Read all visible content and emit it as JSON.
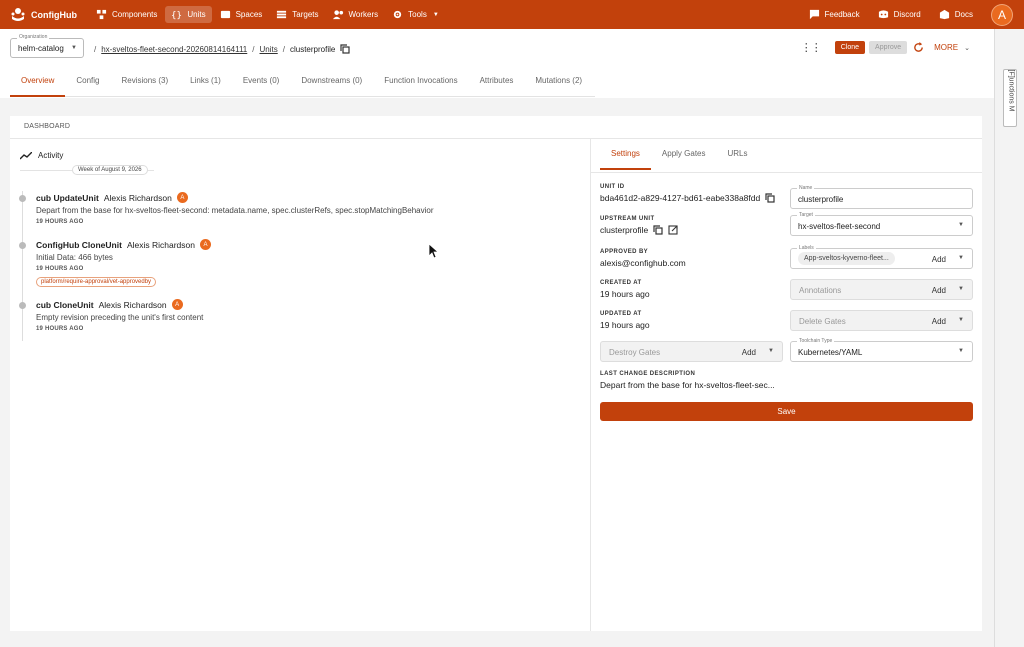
{
  "brand": "ConfigHub",
  "nav": {
    "items": [
      {
        "label": "Components",
        "icon": "components-icon"
      },
      {
        "label": "Units",
        "icon": "braces-icon",
        "active": true
      },
      {
        "label": "Spaces",
        "icon": "spaces-icon"
      },
      {
        "label": "Targets",
        "icon": "targets-icon"
      },
      {
        "label": "Workers",
        "icon": "workers-icon"
      },
      {
        "label": "Tools",
        "icon": "tools-icon"
      }
    ],
    "right": [
      {
        "label": "Feedback",
        "icon": "feedback-icon"
      },
      {
        "label": "Discord",
        "icon": "discord-icon"
      },
      {
        "label": "Docs",
        "icon": "docs-icon"
      }
    ],
    "avatar": "A"
  },
  "org": {
    "label": "Organization",
    "value": "helm-catalog"
  },
  "breadcrumb": {
    "space": "hx-sveltos-fleet-second-20260814164111",
    "units": "Units",
    "current": "clusterprofile",
    "sep": "/"
  },
  "actions": {
    "clone": "Clone",
    "approve": "Approve",
    "more": "MORE"
  },
  "tabs": [
    "Overview",
    "Config",
    "Revisions (3)",
    "Links (1)",
    "Events (0)",
    "Downstreams (0)",
    "Function Invocations",
    "Attributes",
    "Mutations (2)"
  ],
  "sidetab": "[F]unctions M",
  "dashboard": "DASHBOARD",
  "activity": {
    "title": "Activity",
    "week": "Week of August 9, 2026",
    "entries": [
      {
        "cmd": "cub UpdateUnit",
        "user": "Alexis Richardson",
        "avatar": "A",
        "desc": "Depart from the base for hx-sveltos-fleet-second: metadata.name, spec.clusterRefs, spec.stopMatchingBehavior",
        "time": "19 HOURS AGO"
      },
      {
        "cmd": "ConfigHub CloneUnit",
        "user": "Alexis Richardson",
        "avatar": "A",
        "desc": "Initial Data: 466 bytes",
        "time": "19 HOURS AGO",
        "tag": "platform/require-approval/vet-approvedby"
      },
      {
        "cmd": "cub CloneUnit",
        "user": "Alexis Richardson",
        "avatar": "A",
        "desc": "Empty revision preceding the unit's first content",
        "time": "19 HOURS AGO"
      }
    ]
  },
  "settings": {
    "tabs": [
      "Settings",
      "Apply Gates",
      "URLs"
    ],
    "unit_id_label": "UNIT ID",
    "unit_id": "bda461d2-a829-4127-bd61-eabe338a8fdd",
    "upstream_label": "UPSTREAM UNIT",
    "upstream": "clusterprofile",
    "approved_label": "APPROVED BY",
    "approved": "alexis@confighub.com",
    "created_label": "CREATED AT",
    "created": "19 hours ago",
    "updated_label": "UPDATED AT",
    "updated": "19 hours ago",
    "lastchange_label": "LAST CHANGE DESCRIPTION",
    "lastchange": "Depart from the base for hx-sveltos-fleet-sec...",
    "name_label": "Name",
    "name": "clusterprofile",
    "target_label": "Target",
    "target": "hx-sveltos-fleet-second",
    "labels_label": "Labels",
    "labels_chip": "App-sveltos-kyverno-fleet...",
    "annotations": "Annotations",
    "delete_gates": "Delete Gates",
    "destroy_gates": "Destroy Gates",
    "add": "Add",
    "toolchain_label": "Toolchain Type",
    "toolchain": "Kubernetes/YAML",
    "save": "Save"
  }
}
